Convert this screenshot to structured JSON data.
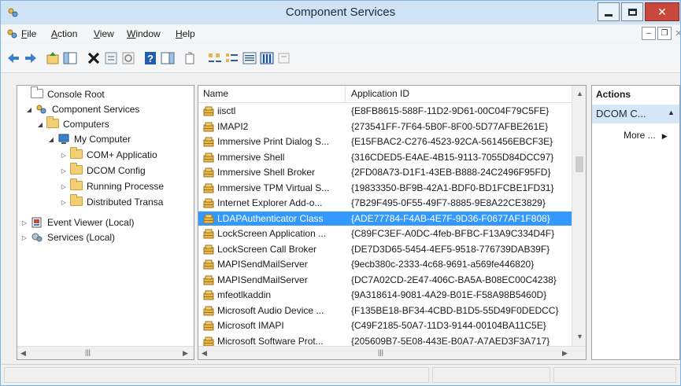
{
  "window": {
    "title": "Component Services"
  },
  "menu": {
    "items": [
      {
        "label": "File",
        "key": "F",
        "rest": "ile"
      },
      {
        "label": "Action",
        "key": "A",
        "rest": "ction"
      },
      {
        "label": "View",
        "key": "V",
        "rest": "iew"
      },
      {
        "label": "Window",
        "key": "W",
        "rest": "indow"
      },
      {
        "label": "Help",
        "key": "H",
        "rest": "elp"
      }
    ]
  },
  "tree": {
    "items": [
      {
        "label": "Console Root"
      },
      {
        "label": "Component Services"
      },
      {
        "label": "Computers"
      },
      {
        "label": "My Computer"
      },
      {
        "label": "COM+ Applicatio"
      },
      {
        "label": "DCOM Config"
      },
      {
        "label": "Running Processe"
      },
      {
        "label": "Distributed Transa"
      },
      {
        "label": "Event Viewer (Local)"
      },
      {
        "label": "Services (Local)"
      }
    ]
  },
  "list": {
    "columns": {
      "name": "Name",
      "appid": "Application ID"
    },
    "rows": [
      {
        "name": "iisctl",
        "appid": "{E8FB8615-588F-11D2-9D61-00C04F79C5FE}"
      },
      {
        "name": "IMAPI2",
        "appid": "{273541FF-7F64-5B0F-8F00-5D77AFBE261E}"
      },
      {
        "name": "Immersive Print Dialog S...",
        "appid": "{E15FBAC2-C276-4523-92CA-561456EBCF3E}"
      },
      {
        "name": "Immersive Shell",
        "appid": "{316CDED5-E4AE-4B15-9113-7055D84DCC97}"
      },
      {
        "name": "Immersive Shell Broker",
        "appid": "{2FD08A73-D1F1-43EB-B888-24C2496F95FD}"
      },
      {
        "name": "Immersive TPM Virtual S...",
        "appid": "{19833350-BF9B-42A1-BDF0-BD1FCBE1FD31}"
      },
      {
        "name": "Internet Explorer Add-o...",
        "appid": "{7B29F495-0F55-49F7-8885-9E8A22CE3829}"
      },
      {
        "name": "LDAPAuthenticator Class",
        "appid": "{ADE77784-F4AB-4E7F-9D36-F0677AF1F808}"
      },
      {
        "name": "LockScreen Application ...",
        "appid": "{C89FC3EF-A0DC-4feb-BFBC-F13A9C334D4F}"
      },
      {
        "name": "LockScreen Call Broker",
        "appid": "{DE7D3D65-5454-4EF5-9518-776739DAB39F}"
      },
      {
        "name": "MAPISendMailServer",
        "appid": "{9ecb380c-2333-4c68-9691-a569fe446820}"
      },
      {
        "name": "MAPISendMailServer",
        "appid": "{DC7A02CD-2E47-406C-BA5A-B08EC00C4238}"
      },
      {
        "name": "mfeotlkaddin",
        "appid": "{9A318614-9081-4A29-B01E-F58A98B5460D}"
      },
      {
        "name": "Microsoft Audio Device ...",
        "appid": "{F135BE18-BF34-4CBD-B1D5-55D49F0DEDCC}"
      },
      {
        "name": "Microsoft IMAPI",
        "appid": "{C49F2185-50A7-11D3-9144-00104BA11C5E}"
      },
      {
        "name": "Microsoft Software Prot...",
        "appid": "{205609B7-5E08-443E-B0A7-A7AED3F3A717}"
      }
    ],
    "selected_index": 7
  },
  "actions": {
    "title": "Actions",
    "section": "DCOM C...",
    "more": "More ..."
  },
  "colors": {
    "selection": "#3399ff",
    "titlebar": "#cfe3f5",
    "close": "#c9483e"
  }
}
